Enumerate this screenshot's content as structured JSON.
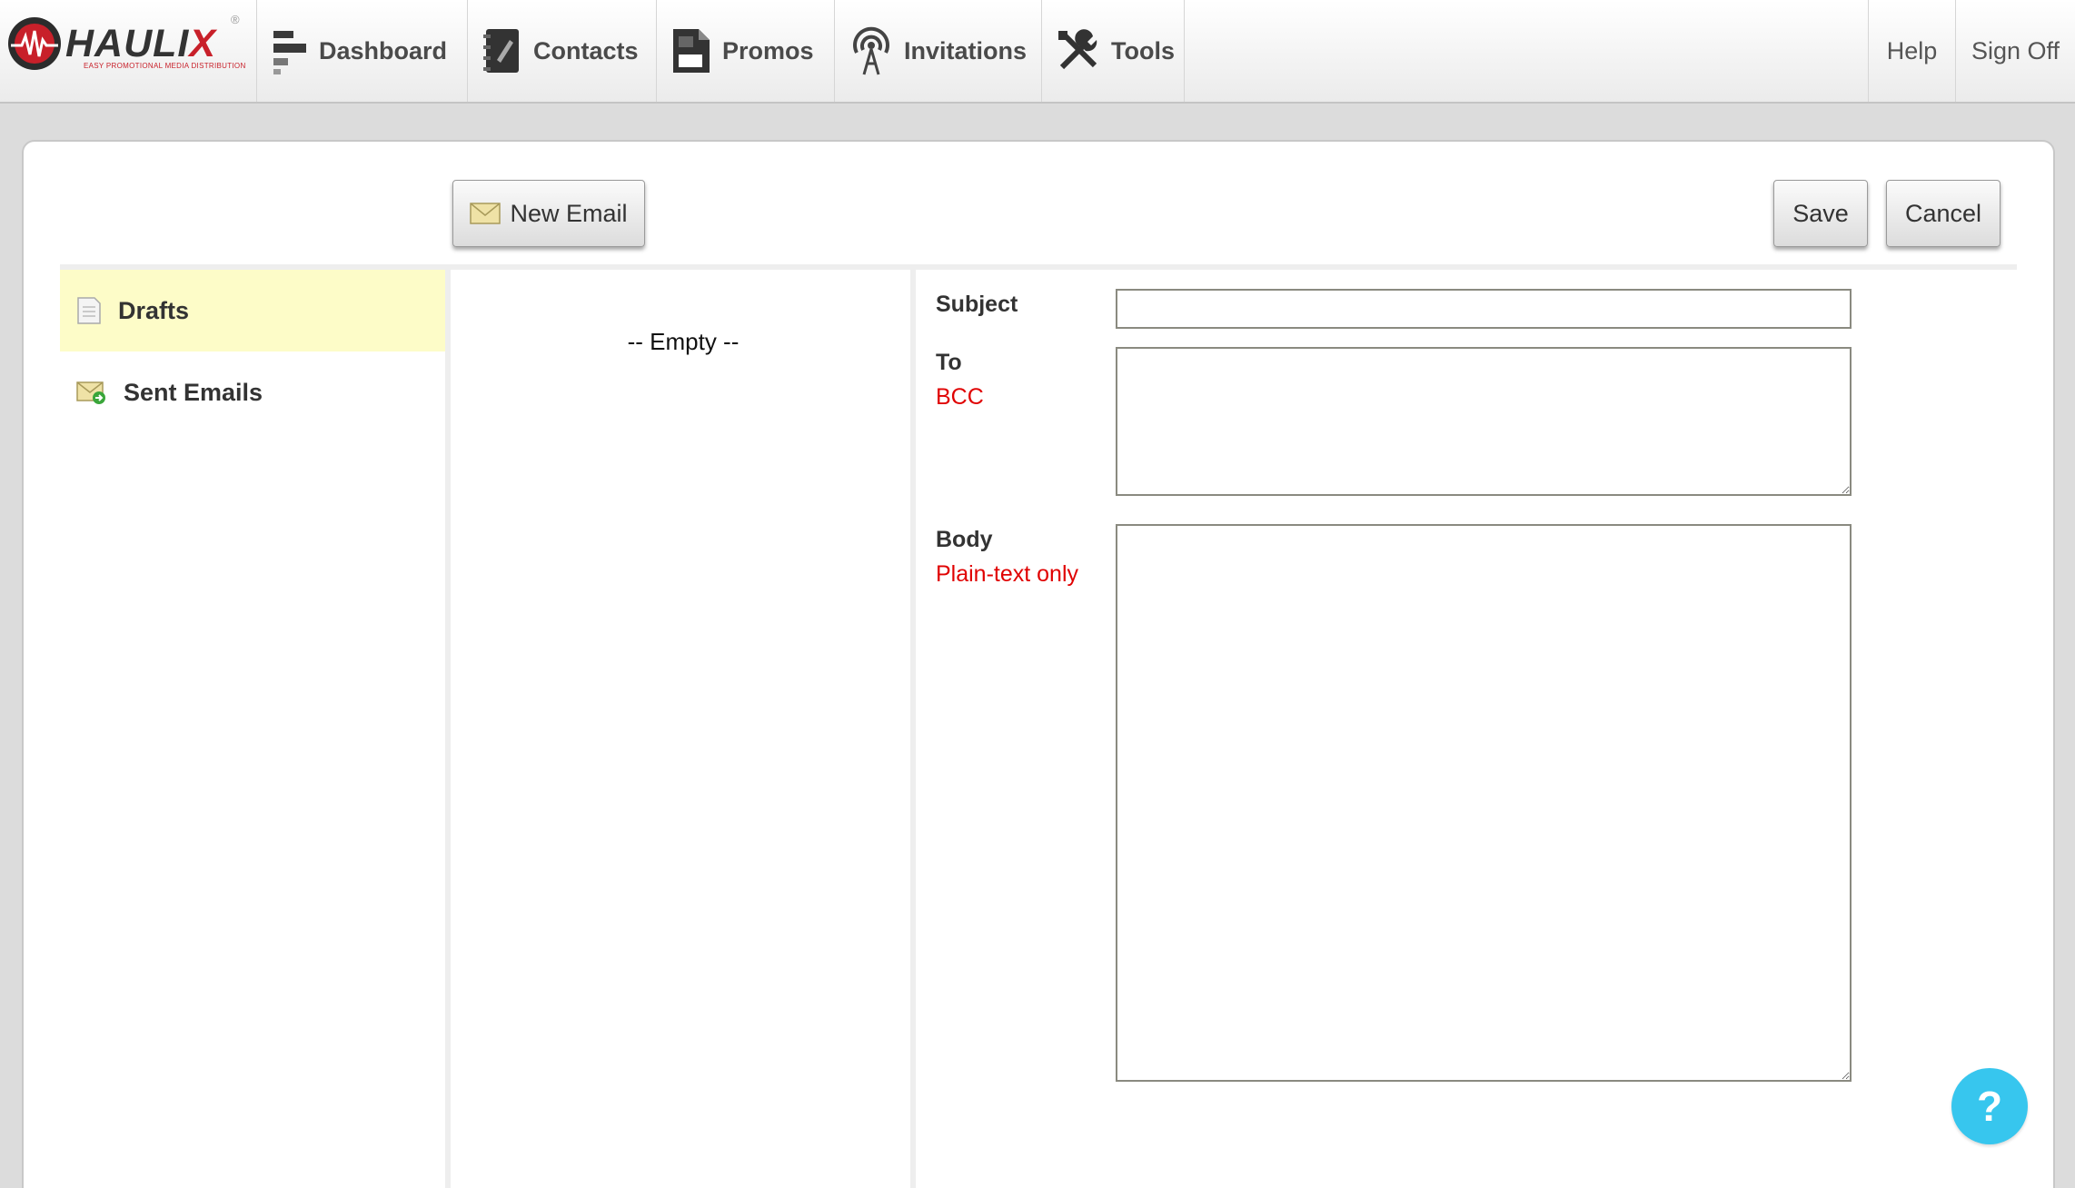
{
  "brand": {
    "name_main": "HAULI",
    "name_accent": "X",
    "registered": "®",
    "tagline": "EASY PROMOTIONAL MEDIA DISTRIBUTION",
    "accent_color": "#c8202a"
  },
  "nav": {
    "items": [
      {
        "label": "Dashboard",
        "icon": "dashboard-icon"
      },
      {
        "label": "Contacts",
        "icon": "contacts-icon"
      },
      {
        "label": "Promos",
        "icon": "promos-icon"
      },
      {
        "label": "Invitations",
        "icon": "invitations-icon"
      },
      {
        "label": "Tools",
        "icon": "tools-icon"
      }
    ],
    "help_label": "Help",
    "signoff_label": "Sign Off"
  },
  "toolbar": {
    "new_email_label": "New Email",
    "save_label": "Save",
    "cancel_label": "Cancel"
  },
  "folders": [
    {
      "label": "Drafts",
      "icon": "draft-icon",
      "active": true
    },
    {
      "label": "Sent Emails",
      "icon": "sent-emails-icon",
      "active": false
    }
  ],
  "message_list": {
    "empty_text": "-- Empty --"
  },
  "form": {
    "subject_label": "Subject",
    "subject_value": "",
    "to_label": "To",
    "to_note": "BCC",
    "to_value": "",
    "body_label": "Body",
    "body_note": "Plain-text only",
    "body_value": ""
  },
  "help_fab": {
    "label": "?",
    "color": "#37c6ee"
  }
}
